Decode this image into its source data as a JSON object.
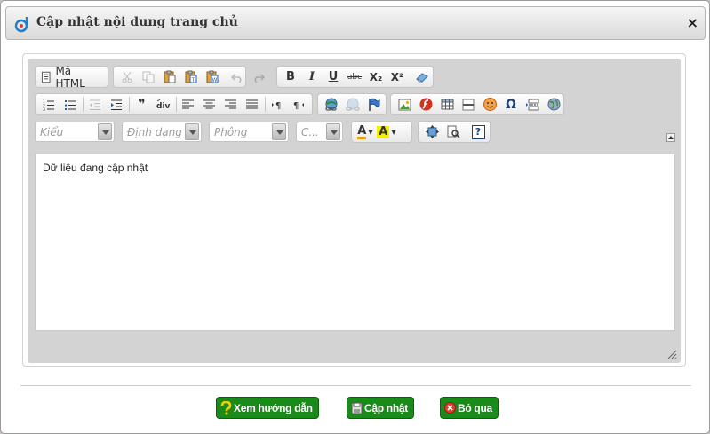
{
  "dialog": {
    "title": "Cập nhật nội dung trang chủ",
    "close_label": "×"
  },
  "toolbar": {
    "source_label": "Mã HTML",
    "row1": [
      "cut-icon",
      "copy-icon",
      "paste-icon",
      "paste-text-icon",
      "paste-word-icon",
      "undo-icon",
      "redo-icon",
      "bold-icon",
      "italic-icon",
      "underline-icon",
      "strike-icon",
      "subscript-icon",
      "superscript-icon",
      "remove-format-icon"
    ],
    "bold_glyph": "B",
    "italic_glyph": "I",
    "underline_glyph": "U",
    "strike_glyph": "abc",
    "sub_glyph": "X₂",
    "sup_glyph": "X²",
    "style_placeholder": "Kiểu",
    "format_placeholder": "Định dạng",
    "font_placeholder": "Phông",
    "size_placeholder": "C...",
    "text_color_glyph": "A",
    "bg_color_glyph": "A",
    "help_glyph": "?",
    "blockquote_glyph": "❞",
    "omega_glyph": "Ω"
  },
  "editor": {
    "content": "Dữ liệu đang cập nhật"
  },
  "actions": {
    "help_label": "Xem hướng dẫn",
    "update_label": "Cập nhật",
    "cancel_label": "Bỏ qua"
  },
  "colors": {
    "action_green": "#1a8a1a",
    "editor_gray": "#d3d3d3"
  }
}
